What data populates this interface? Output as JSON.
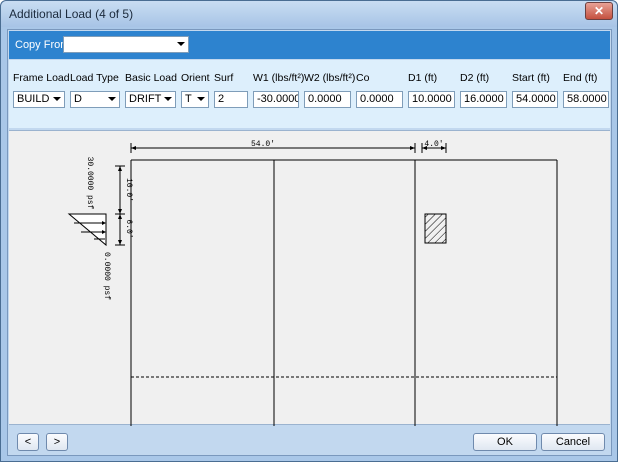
{
  "window": {
    "title": "Additional Load (4 of 5)",
    "close_glyph": "✕"
  },
  "copy_from": {
    "label": "Copy From",
    "value": ""
  },
  "params": {
    "frame_load": {
      "label": "Frame Load",
      "value": "BUILD"
    },
    "load_type": {
      "label": "Load Type",
      "value": "D"
    },
    "basic_load": {
      "label": "Basic Load",
      "value": "DRIFT"
    },
    "orient": {
      "label": "Orient",
      "value": "T"
    },
    "surf": {
      "label": "Surf",
      "value": "2"
    },
    "w1": {
      "label": "W1 (lbs/ft²)",
      "value": "-30.0000"
    },
    "w2": {
      "label": "W2 (lbs/ft²)",
      "value": "0.0000"
    },
    "co": {
      "label": "Co",
      "value": "0.0000"
    },
    "d1": {
      "label": "D1 (ft)",
      "value": "10.0000"
    },
    "d2": {
      "label": "D2 (ft)",
      "value": "16.0000"
    },
    "start": {
      "label": "Start (ft)",
      "value": "54.0000"
    },
    "end": {
      "label": "End (ft)",
      "value": "58.0000"
    }
  },
  "drawing": {
    "dim_top_main": "54.0'",
    "dim_top_small": "4.0'",
    "dim_left_upper": "10.0'",
    "dim_left_lower": "6.0'",
    "load_top": "30.0000 psf",
    "load_bottom": "0.0000 psf"
  },
  "footer": {
    "prev": "<",
    "next": ">",
    "ok": "OK",
    "cancel": "Cancel"
  }
}
